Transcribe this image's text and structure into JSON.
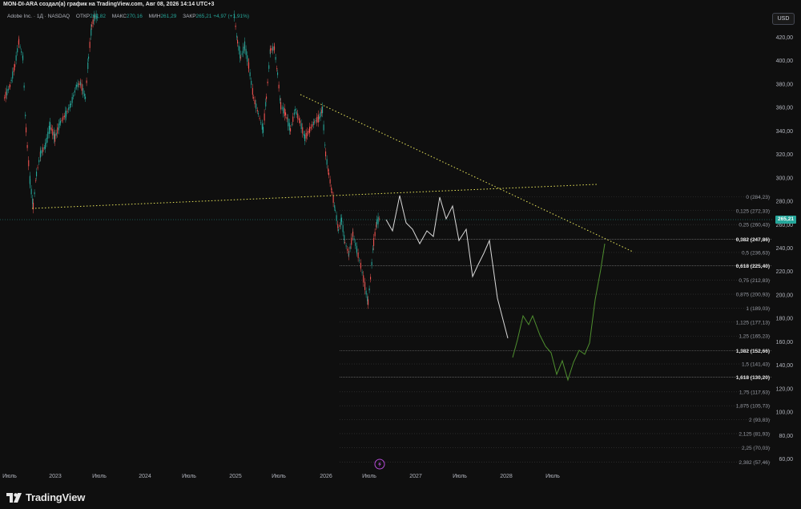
{
  "header": {
    "attribution": "MON-DI-ARA создал(а) график на TradingView.com, Авг 08, 2026 14:14 UTC+3"
  },
  "legend": {
    "symbol": "Adobe Inc. · 1Д · NASDAQ",
    "open_label": "ОТКР",
    "open_value": "262,82",
    "high_label": "МАКС",
    "high_value": "270,16",
    "low_label": "МИН",
    "low_value": "261,29",
    "close_label": "ЗАКР",
    "close_value": "265,21",
    "change": "+4,97 (+1,91%)"
  },
  "currency": "USD",
  "current_price_tag": "265,21",
  "colors": {
    "up": "#26a69a",
    "down": "#ef5350",
    "trendline": "#e6e35a",
    "projection_white": "#d9d9d9",
    "projection_green": "#4f8f2f",
    "fib_line": "#3a3a3a"
  },
  "price_axis": {
    "labels": [
      "420,00",
      "400,00",
      "380,00",
      "360,00",
      "340,00",
      "320,00",
      "300,00",
      "280,00",
      "260,00",
      "240,00",
      "220,00",
      "200,00",
      "180,00",
      "160,00",
      "140,00",
      "120,00",
      "100,00",
      "80,00",
      "60,00"
    ]
  },
  "time_axis": {
    "labels": [
      "Июль",
      "2023",
      "Июль",
      "2024",
      "Июль",
      "2025",
      "Июль",
      "2026",
      "Июль",
      "2027",
      "Июль",
      "2028",
      "Июль"
    ]
  },
  "fib_levels": [
    {
      "label": "0 (284,23)",
      "value": 284.23,
      "bold": false
    },
    {
      "label": "0,125 (272,33)",
      "value": 272.33,
      "bold": false
    },
    {
      "label": "0,25 (260,43)",
      "value": 260.43,
      "bold": false
    },
    {
      "label": "0,382 (247,86)",
      "value": 247.86,
      "bold": true
    },
    {
      "label": "0,5 (236,63)",
      "value": 236.63,
      "bold": false
    },
    {
      "label": "0,618 (225,40)",
      "value": 225.4,
      "bold": true
    },
    {
      "label": "0,75 (212,83)",
      "value": 212.83,
      "bold": false
    },
    {
      "label": "0,875 (200,93)",
      "value": 200.93,
      "bold": false
    },
    {
      "label": "1 (189,03)",
      "value": 189.03,
      "bold": false
    },
    {
      "label": "1,125 (177,13)",
      "value": 177.13,
      "bold": false
    },
    {
      "label": "1,25 (165,23)",
      "value": 165.23,
      "bold": false
    },
    {
      "label": "1,382 (152,66)",
      "value": 152.66,
      "bold": true
    },
    {
      "label": "1,5 (141,43)",
      "value": 141.43,
      "bold": false
    },
    {
      "label": "1,618 (130,20)",
      "value": 130.2,
      "bold": true
    },
    {
      "label": "1,75 (117,63)",
      "value": 117.63,
      "bold": false
    },
    {
      "label": "1,875 (105,73)",
      "value": 105.73,
      "bold": false
    },
    {
      "label": "2 (93,83)",
      "value": 93.83,
      "bold": false
    },
    {
      "label": "2,125 (81,93)",
      "value": 81.93,
      "bold": false
    },
    {
      "label": "2,25 (70,03)",
      "value": 70.03,
      "bold": false
    },
    {
      "label": "2,382 (57,46)",
      "value": 57.46,
      "bold": false
    }
  ],
  "footer": {
    "brand": "TradingView"
  }
}
